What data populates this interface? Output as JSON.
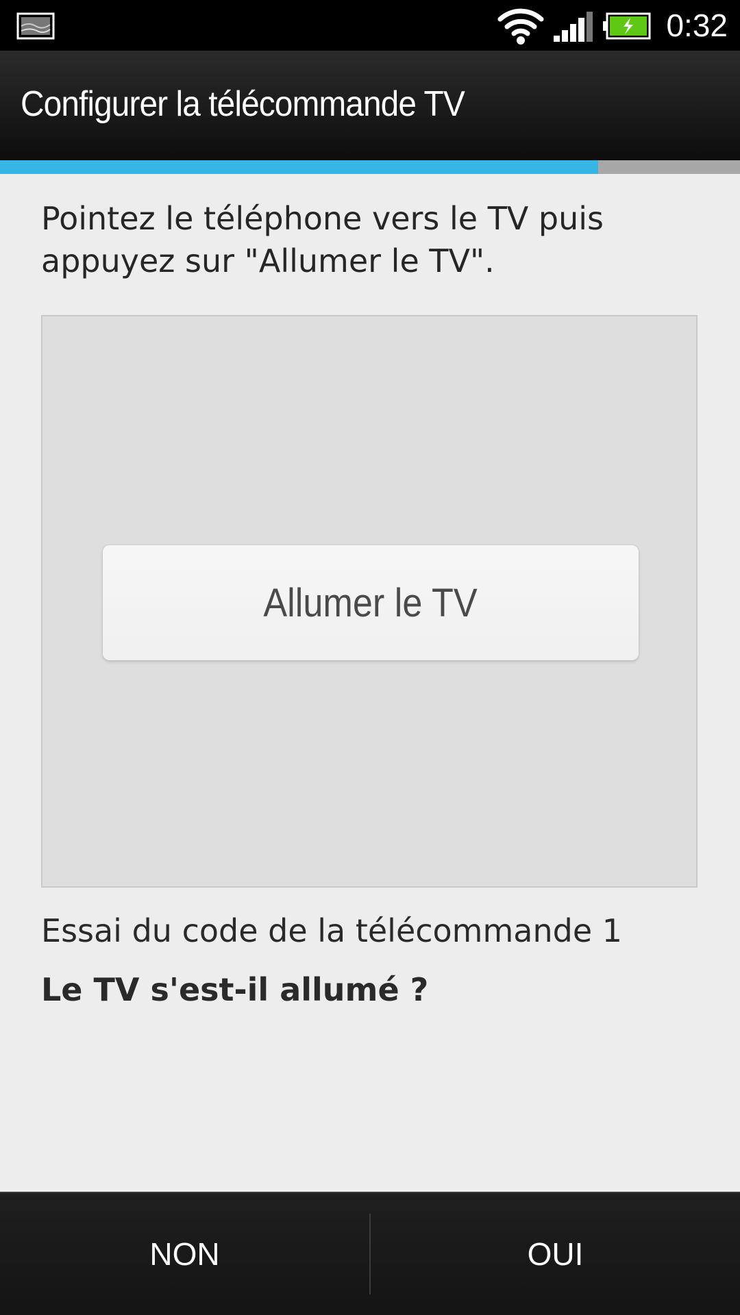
{
  "status_bar": {
    "time": "0:32",
    "icons": [
      "notification-image-icon",
      "wifi-icon",
      "signal-icon",
      "battery-charging-icon"
    ]
  },
  "header": {
    "title": "Configurer la télécommande TV"
  },
  "progress": {
    "fraction": 0.808
  },
  "main": {
    "instruction": "Pointez le téléphone vers le TV puis appuyez sur \"Allumer le TV\".",
    "power_button_label": "Allumer le TV",
    "code_status": "Essai du code de la télécommande 1",
    "question": "Le TV s'est-il allumé ?"
  },
  "footer": {
    "no_label": "NON",
    "yes_label": "OUI"
  },
  "colors": {
    "accent": "#36b6e4",
    "battery": "#5fc814"
  }
}
